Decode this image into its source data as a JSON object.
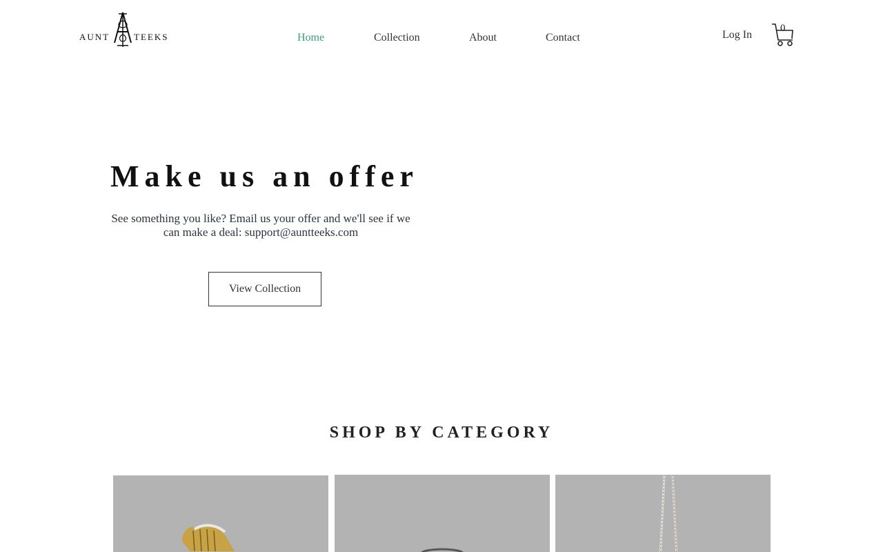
{
  "header": {
    "logo": {
      "word_left": "AUNT",
      "word_right": "TEEKS"
    },
    "nav": [
      {
        "label": "Home",
        "active": true
      },
      {
        "label": "Collection",
        "active": false
      },
      {
        "label": "About",
        "active": false
      },
      {
        "label": "Contact",
        "active": false
      }
    ],
    "login_label": "Log In",
    "cart_count": "0",
    "colors": {
      "active_nav": "#3d9b7f",
      "text": "#333333"
    }
  },
  "hero": {
    "title": "Make us an offer",
    "text": "See something you like? Email us your offer and we'll see if we can make a deal: support@auntteeks.com",
    "button_label": "View Collection"
  },
  "categories": {
    "title": "SHOP BY CATEGORY",
    "cards": [
      {
        "name": "harp-brooch-image"
      },
      {
        "name": "ring-image"
      },
      {
        "name": "chain-necklace-image"
      }
    ],
    "colors": {
      "card_bg": "#b3b3b3"
    }
  }
}
